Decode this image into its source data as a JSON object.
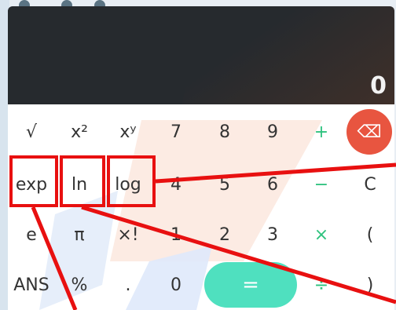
{
  "display": {
    "value": "0"
  },
  "keys": {
    "sqrt": "√",
    "square": "x²",
    "power": "xʸ",
    "seven": "7",
    "eight": "8",
    "nine": "9",
    "plus": "+",
    "backspace": "⌫",
    "exp": "exp",
    "ln": "ln",
    "log": "log",
    "four": "4",
    "five": "5",
    "six": "6",
    "minus": "−",
    "clear": "C",
    "e": "e",
    "pi": "π",
    "factorial": "×!",
    "one": "1",
    "two": "2",
    "three": "3",
    "times": "×",
    "lparen": "(",
    "ans": "ANS",
    "percent": "%",
    "dot": ".",
    "zero": "0",
    "equals": "=",
    "divide": "÷",
    "rparen": ")"
  },
  "colors": {
    "accent_green": "#2ec27e",
    "backspace_red": "#e85540",
    "equals_mint": "#4fe0bf",
    "annotation_red": "#e81010"
  }
}
